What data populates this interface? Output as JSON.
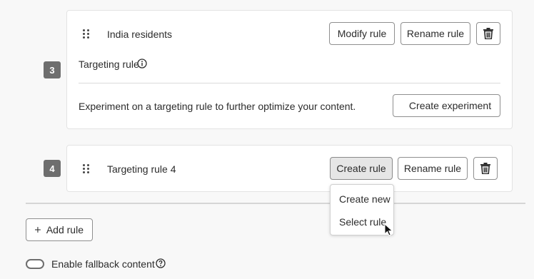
{
  "rules": [
    {
      "number": "3",
      "name": "India residents",
      "modify_label": "Modify rule",
      "rename_label": "Rename rule",
      "type_label": "Targeting rule",
      "experiment_text": "Experiment on a targeting rule to further optimize your content.",
      "experiment_button": "Create experiment"
    },
    {
      "number": "4",
      "name": "Targeting rule 4",
      "create_label": "Create rule",
      "rename_label": "Rename rule"
    }
  ],
  "create_menu": {
    "items": [
      "Create new",
      "Select rule"
    ]
  },
  "add_rule_label": "Add rule",
  "fallback": {
    "label": "Enable fallback content",
    "enabled": false
  },
  "icons": {
    "drag": "drag-handle-icon",
    "delete": "trash-icon",
    "info": "info-icon",
    "experiment": "beaker-icon",
    "add": "plus-icon",
    "help": "help-icon",
    "cursor": "pointer-cursor-icon"
  }
}
